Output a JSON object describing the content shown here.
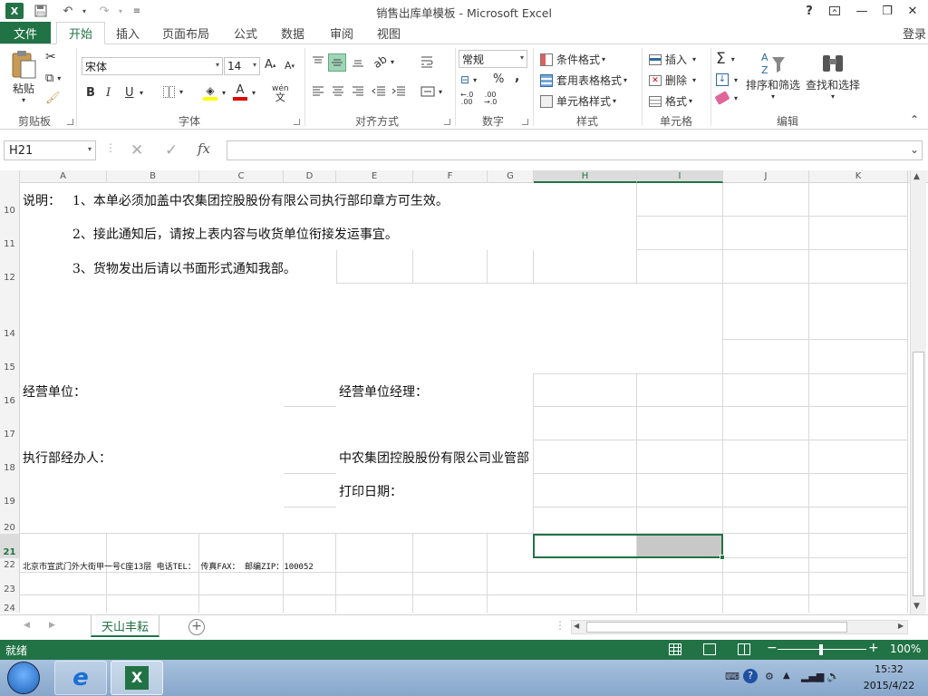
{
  "window": {
    "title": "销售出库单模板 - Microsoft Excel",
    "help": "?",
    "login": "登录"
  },
  "tabs": [
    "文件",
    "开始",
    "插入",
    "页面布局",
    "公式",
    "数据",
    "审阅",
    "视图"
  ],
  "ribbon": {
    "clipboard": {
      "paste": "粘贴",
      "label": "剪贴板"
    },
    "font": {
      "name": "宋体",
      "size": "14",
      "bold": "B",
      "italic": "I",
      "underline": "U",
      "wen": "wén",
      "label": "字体"
    },
    "align": {
      "label": "对齐方式"
    },
    "number": {
      "format": "常规",
      "percent": "%",
      "comma": ",",
      "label": "数字"
    },
    "styles": {
      "cond": "条件格式",
      "table": "套用表格格式",
      "cell": "单元格样式",
      "label": "样式"
    },
    "cells": {
      "insert": "插入",
      "delete": "删除",
      "format": "格式",
      "label": "单元格"
    },
    "editing": {
      "sort": "排序和筛选",
      "find": "查找和选择",
      "label": "编辑"
    }
  },
  "formula": {
    "namebox": "H21",
    "fx": "fx",
    "value": ""
  },
  "columns": [
    "A",
    "B",
    "C",
    "D",
    "E",
    "F",
    "G",
    "H",
    "I",
    "J",
    "K"
  ],
  "rows": [
    "10",
    "11",
    "12",
    "14",
    "15",
    "16",
    "17",
    "18",
    "19",
    "20",
    "21",
    "22",
    "23",
    "24"
  ],
  "cells": {
    "note_label": "说明：",
    "note1": "1、本单必须加盖中农集团控股股份有限公司执行部印章方可生效。",
    "note2": "2、接此通知后，请按上表内容与收货单位衔接发运事宜。",
    "note3": "3、货物发出后请以书面形式通知我部。",
    "unit": "经营单位：",
    "unit_manager": "经营单位经理：",
    "handler": "执行部经办人：",
    "company_dept": "中农集团控股股份有限公司业管部",
    "print_date": "打印日期：",
    "address": "北京市宣武门外大街甲一号C座13层    电话TEL：  传真FAX：  邮编ZIP：100052"
  },
  "sheet": {
    "name": "天山丰耘"
  },
  "status": {
    "ready": "就绪",
    "zoom": "100%"
  },
  "taskbar": {
    "time": "15:32",
    "date": "2015/4/22"
  },
  "colors": {
    "accent": "#217346"
  }
}
